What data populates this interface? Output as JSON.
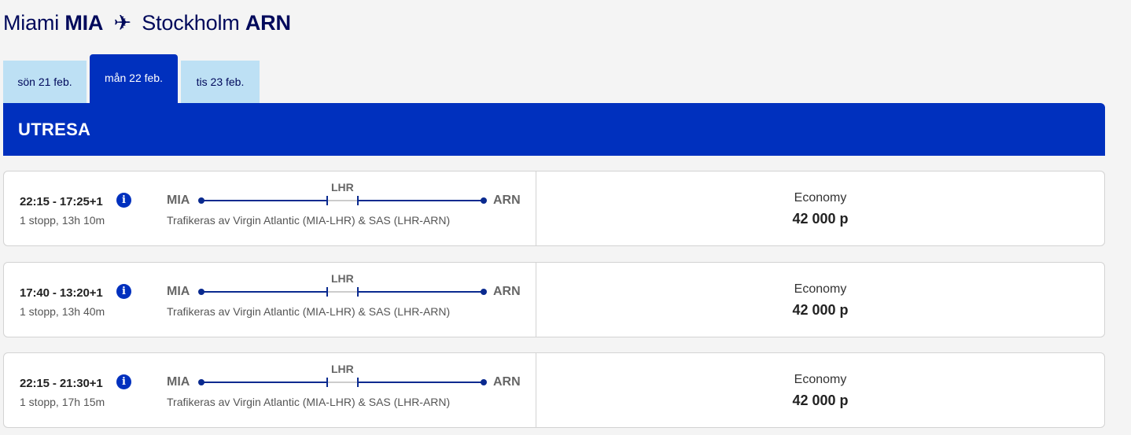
{
  "header": {
    "origin_city": "Miami",
    "origin_code": "MIA",
    "plane_icon": "✈",
    "dest_city": "Stockholm",
    "dest_code": "ARN"
  },
  "tabs": [
    {
      "label": "sön 21 feb.",
      "selected": false
    },
    {
      "label": "mån 22 feb.",
      "selected": true
    },
    {
      "label": "tis 23 feb.",
      "selected": false
    }
  ],
  "section": {
    "title": "UTRESA"
  },
  "flights": [
    {
      "times": "22:15 - 17:25+1",
      "duration": "1 stopp, 13h 10m",
      "origin": "MIA",
      "via": "LHR",
      "dest": "ARN",
      "operator": "Trafikeras av Virgin Atlantic (MIA-LHR) & SAS (LHR-ARN)",
      "cabin": "Economy",
      "price": "42 000 p"
    },
    {
      "times": "17:40 - 13:20+1",
      "duration": "1 stopp, 13h 40m",
      "origin": "MIA",
      "via": "LHR",
      "dest": "ARN",
      "operator": "Trafikeras av Virgin Atlantic (MIA-LHR) & SAS (LHR-ARN)",
      "cabin": "Economy",
      "price": "42 000 p"
    },
    {
      "times": "22:15 - 21:30+1",
      "duration": "1 stopp, 17h 15m",
      "origin": "MIA",
      "via": "LHR",
      "dest": "ARN",
      "operator": "Trafikeras av Virgin Atlantic (MIA-LHR) & SAS (LHR-ARN)",
      "cabin": "Economy",
      "price": "42 000 p"
    }
  ],
  "icons": {
    "info": "i"
  },
  "colors": {
    "brand_blue": "#0030be",
    "navy_text": "#00095b",
    "tab_light": "#bde0f4",
    "route_line": "#0a2a8f"
  }
}
